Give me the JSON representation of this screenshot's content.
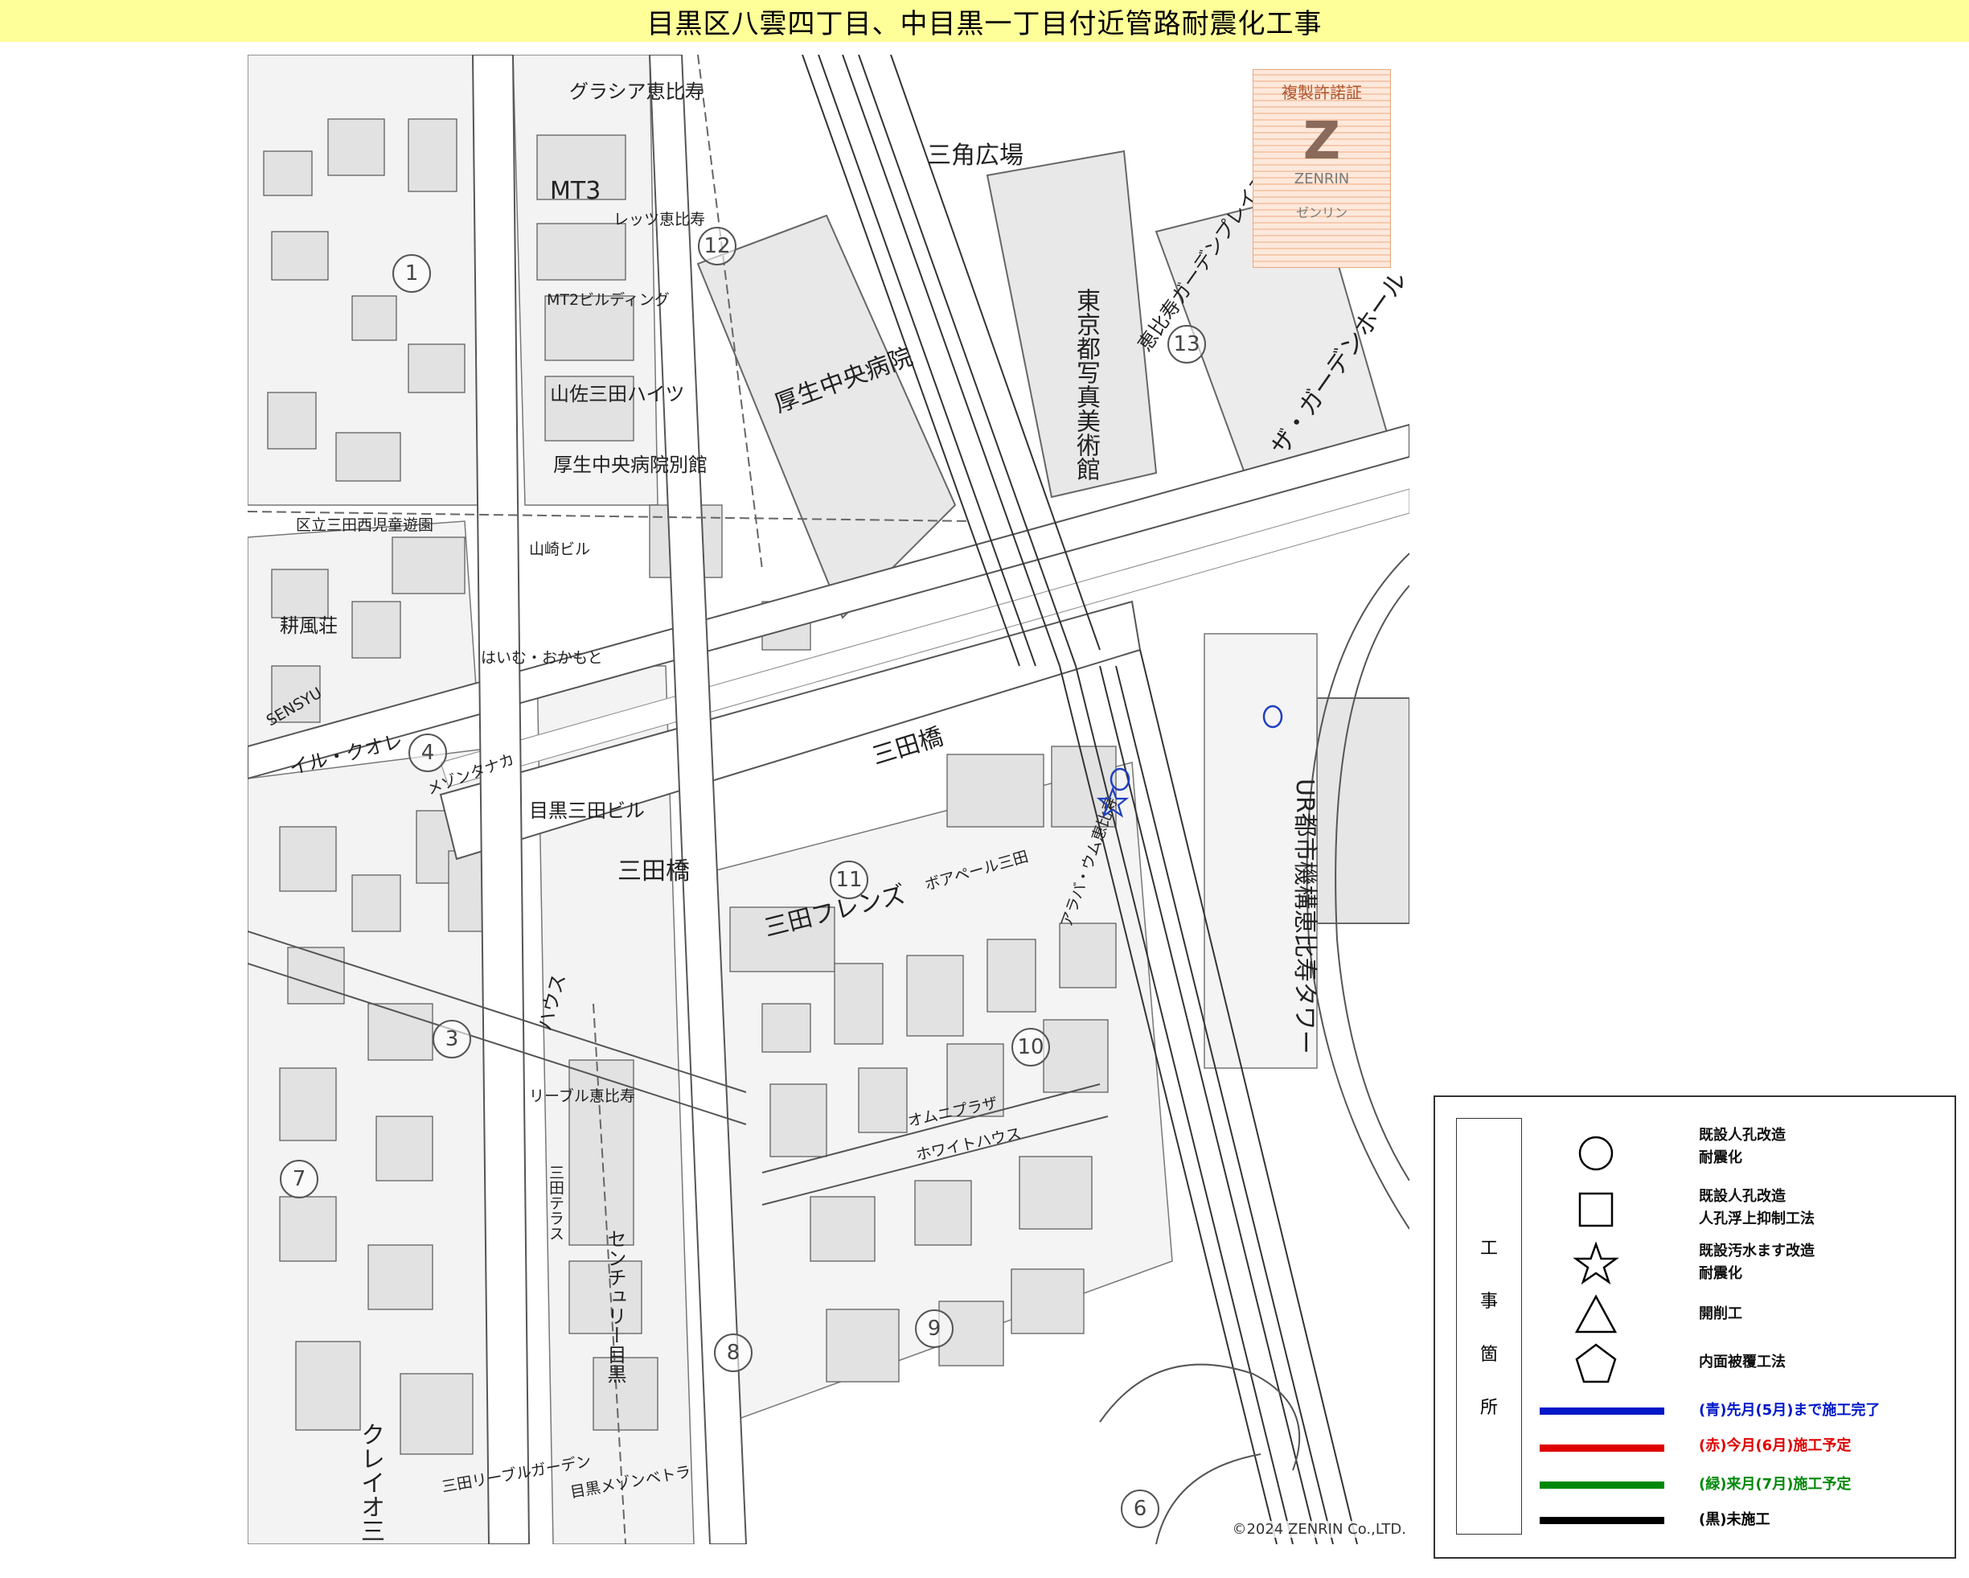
{
  "title": "目黒区八雲四丁目、中目黒一丁目付近管路耐震化工事",
  "map": {
    "place_labels": [
      "三田橋",
      "三田橋",
      "三角広場",
      "厚生中央病院",
      "厚生中央病院別館",
      "山佐三田ハイツ",
      "MT2ビルディング",
      "MT3",
      "レッツ恵比寿",
      "グラシア恵比寿",
      "東京都写真美術館",
      "ザ・ガーデンホール",
      "恵比寿ガーデンプレイス郵便局",
      "UR都市機構恵比寿タワー",
      "三田フレンズ",
      "ボアペール三田",
      "アラバ・ウム恵比寿",
      "目黒三田ビル",
      "山崎ビル",
      "区立三田西児童遊園",
      "耕風荘",
      "メゾンタナカ",
      "ハウス",
      "センチュリー目黒",
      "三田リーブルガーデン",
      "目黒メゾンベトラ",
      "クレイオ三田",
      "はいむ・おかもと",
      "SENSYU",
      "イル・クオレ",
      "三田テラス",
      "リーブル恵比寿",
      "オムニプラザ",
      "ホワイトハウス"
    ],
    "numbered_markers": [
      "1",
      "4",
      "6",
      "8",
      "9",
      "10",
      "11",
      "12",
      "13",
      "3",
      "7"
    ],
    "stamp": {
      "title": "複製許諾証",
      "brand": "ZENRIN",
      "kana": "ゼンリン"
    },
    "copyright": "©2024 ZENRIN Co.,LTD.",
    "construction_marks": [
      {
        "symbol": "circle",
        "color": "#1f3fbf"
      },
      {
        "symbol": "circle",
        "color": "#1f3fbf"
      },
      {
        "symbol": "star",
        "color": "#1f3fbf"
      }
    ]
  },
  "legend": {
    "heading": [
      "工",
      "事",
      "箇",
      "所"
    ],
    "symbols": [
      {
        "icon": "circle",
        "line1": "既設人孔改造",
        "line2": "耐震化"
      },
      {
        "icon": "square",
        "line1": "既設人孔改造",
        "line2": "人孔浮上抑制工法"
      },
      {
        "icon": "star",
        "line1": "既設汚水ます改造",
        "line2": "耐震化"
      },
      {
        "icon": "triangle",
        "line1": "開削工",
        "line2": ""
      },
      {
        "icon": "pentagon",
        "line1": "内面被覆工法",
        "line2": ""
      }
    ],
    "lines": [
      {
        "color": "#0018c8",
        "label": "(青)先月(5月)まで施工完了"
      },
      {
        "color": "#e00000",
        "label": "(赤)今月(6月)施工予定"
      },
      {
        "color": "#00880a",
        "label": "(緑)来月(7月)施工予定"
      },
      {
        "color": "#000000",
        "label": "(黒)未施工"
      }
    ]
  }
}
